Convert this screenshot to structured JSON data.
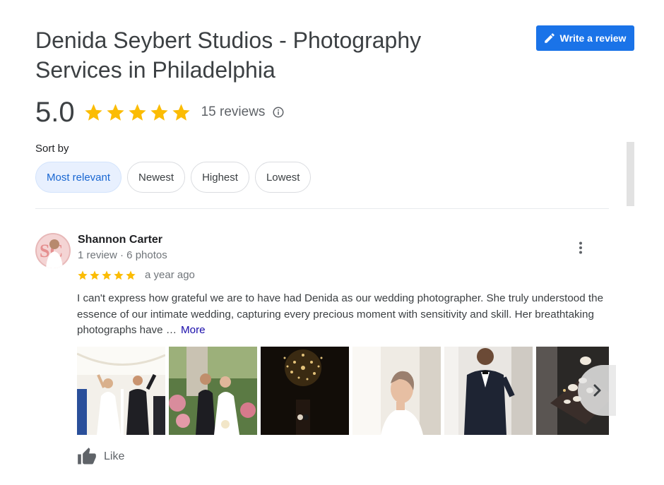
{
  "header": {
    "title": "Denida Seybert Studios - Photography Services in Philadelphia",
    "write_review_label": "Write a review"
  },
  "summary": {
    "rating": "5.0",
    "stars": 5,
    "review_count": "15 reviews"
  },
  "sort": {
    "label": "Sort by",
    "options": [
      {
        "label": "Most relevant",
        "selected": true
      },
      {
        "label": "Newest",
        "selected": false
      },
      {
        "label": "Highest",
        "selected": false
      },
      {
        "label": "Lowest",
        "selected": false
      }
    ]
  },
  "review": {
    "reviewer_name": "Shannon Carter",
    "reviewer_meta": "1 review · 6 photos",
    "stars": 5,
    "date": "a year ago",
    "text": "I can't express how grateful we are to have had Denida as our wedding photographer. She truly understood the essence of our intimate wedding, capturing every precious moment with sensitivity and skill. Her breathtaking photographs have …",
    "more_label": "More",
    "like_label": "Like"
  },
  "colors": {
    "accent": "#1a73e8",
    "star": "#fbbc04",
    "chip_selected_bg": "#e8f0fe",
    "chip_selected_text": "#1967d2",
    "link": "#1a0dab"
  },
  "icons": {
    "write_review": "pencil-icon",
    "info": "info-icon",
    "menu": "more-vert-icon",
    "next": "chevron-right-icon",
    "like": "thumb-up-icon"
  }
}
